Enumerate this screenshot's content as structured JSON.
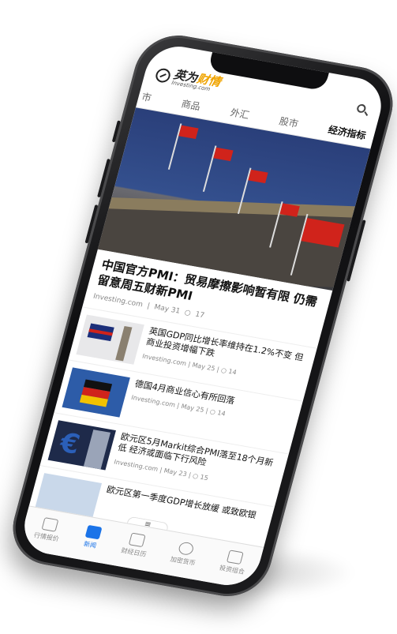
{
  "app": {
    "logo_cn_a": "英为",
    "logo_cn_b": "财情",
    "logo_en": "Investing.com"
  },
  "tabs": [
    "市",
    "商品",
    "外汇",
    "股市",
    "经济指标"
  ],
  "active_tab": "经济指标",
  "hero": {
    "title": "中国官方PMI：贸易摩擦影响暂有限 仍需留意周五财新PMI",
    "source": "Investing.com",
    "date": "May 31",
    "comments": "17"
  },
  "news": [
    {
      "title": "英国GDP同比增长率维持在1.2%不变 但商业投资增幅下跌",
      "source": "Investing.com",
      "date": "May 25",
      "comments": "14"
    },
    {
      "title": "德国4月商业信心有所回落",
      "source": "Investing.com",
      "date": "May 25",
      "comments": "14"
    },
    {
      "title": "欧元区5月Markit综合PMI落至18个月新低 经济或面临下行风险",
      "source": "Investing.com",
      "date": "May 23",
      "comments": "15"
    },
    {
      "title": "欧元区第一季度GDP增长放缓 或致欧银",
      "source": "",
      "date": "",
      "comments": ""
    }
  ],
  "tabbar": [
    {
      "label": "行情报价",
      "icon": "chart-line-icon"
    },
    {
      "label": "新闻",
      "icon": "news-icon"
    },
    {
      "label": "财经日历",
      "icon": "calendar-icon"
    },
    {
      "label": "加密货币",
      "icon": "bitcoin-icon"
    },
    {
      "label": "投资组合",
      "icon": "briefcase-icon"
    }
  ],
  "handle_icon": "≡",
  "colors": {
    "accent": "#1a73e8",
    "logo_yellow": "#f0a400",
    "flag_red": "#d0231b"
  }
}
